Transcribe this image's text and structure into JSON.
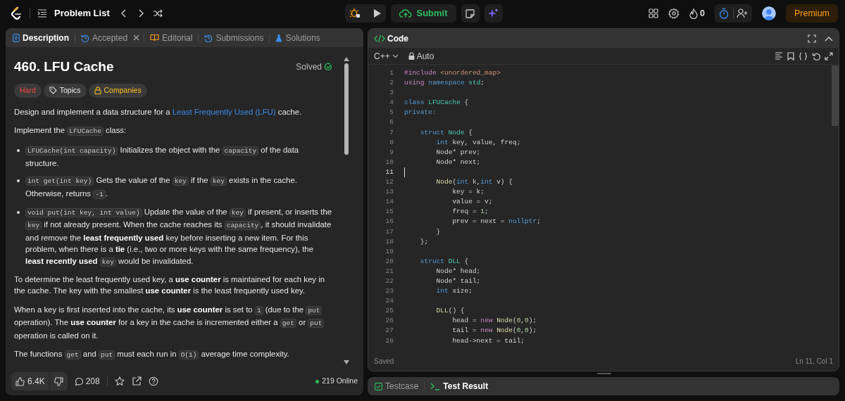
{
  "top_bar": {
    "problem_list": "Problem List",
    "submit": "Submit",
    "streak": "0",
    "premium": "Premium"
  },
  "description_panel": {
    "tabs": [
      {
        "label": "Description",
        "selected": true
      },
      {
        "label": "Accepted",
        "selected": false
      },
      {
        "label": "Editorial",
        "selected": false
      },
      {
        "label": "Submissions",
        "selected": false
      },
      {
        "label": "Solutions",
        "selected": false
      }
    ],
    "title": "460. LFU Cache",
    "status": "Solved",
    "tags": [
      {
        "label": "Hard",
        "kind": "difficulty"
      },
      {
        "label": "Topics",
        "kind": "topics"
      },
      {
        "label": "Companies",
        "kind": "companies"
      }
    ],
    "content": [
      {
        "kind": "paragraph",
        "segments": [
          {
            "kind": "text",
            "text": "Design and implement a data structure for a "
          },
          {
            "kind": "link",
            "text": "Least Frequently Used (LFU)"
          },
          {
            "kind": "text",
            "text": " cache."
          }
        ]
      },
      {
        "kind": "paragraph",
        "segments": [
          {
            "kind": "text",
            "text": "Implement the "
          },
          {
            "kind": "code",
            "text": "LFUCache"
          },
          {
            "kind": "text",
            "text": " class:"
          }
        ]
      },
      {
        "kind": "bullets",
        "items": [
          {
            "segments": [
              {
                "kind": "code",
                "text": "LFUCache(int capacity)"
              },
              {
                "kind": "text",
                "text": " Initializes the object with the "
              },
              {
                "kind": "code",
                "text": "capacity"
              },
              {
                "kind": "text",
                "text": " of the data structure."
              }
            ]
          },
          {
            "segments": [
              {
                "kind": "code",
                "text": "int get(int key)"
              },
              {
                "kind": "text",
                "text": " Gets the value of the "
              },
              {
                "kind": "code",
                "text": "key"
              },
              {
                "kind": "text",
                "text": " if the "
              },
              {
                "kind": "code",
                "text": "key"
              },
              {
                "kind": "text",
                "text": " exists in the cache. Otherwise, returns "
              },
              {
                "kind": "code",
                "text": "-1"
              },
              {
                "kind": "text",
                "text": "."
              }
            ]
          },
          {
            "segments": [
              {
                "kind": "code",
                "text": "void put(int key, int value)"
              },
              {
                "kind": "text",
                "text": " Update the value of the "
              },
              {
                "kind": "code",
                "text": "key"
              },
              {
                "kind": "text",
                "text": " if present, or inserts the "
              },
              {
                "kind": "code",
                "text": "key"
              },
              {
                "kind": "text",
                "text": " if not already present. When the cache reaches its "
              },
              {
                "kind": "code",
                "text": "capacity"
              },
              {
                "kind": "text",
                "text": ", it should invalidate and remove the **least frequently used** key before inserting a new item. For this problem, when there is a **tie** (i.e., two or more keys with the same frequency), the **least recently used** "
              },
              {
                "kind": "code",
                "text": "key"
              },
              {
                "kind": "text",
                "text": " would be invalidated."
              }
            ]
          }
        ]
      },
      {
        "kind": "paragraph",
        "segments": [
          {
            "kind": "text",
            "text": "To determine the least frequently used key, a **use counter** is maintained for each key in the cache. The key with the smallest **use counter** is the least frequently used key."
          }
        ]
      },
      {
        "kind": "paragraph",
        "segments": [
          {
            "kind": "text",
            "text": "When a key is first inserted into the cache, its **use counter** is set to "
          },
          {
            "kind": "code",
            "text": "1"
          },
          {
            "kind": "text",
            "text": " (due to the "
          },
          {
            "kind": "code",
            "text": "put"
          },
          {
            "kind": "text",
            "text": " operation). The **use counter** for a key in the cache is incremented either a "
          },
          {
            "kind": "code",
            "text": "get"
          },
          {
            "kind": "text",
            "text": " or "
          },
          {
            "kind": "code",
            "text": "put"
          },
          {
            "kind": "text",
            "text": " operation is called on it."
          }
        ]
      },
      {
        "kind": "paragraph",
        "segments": [
          {
            "kind": "text",
            "text": "The functions "
          },
          {
            "kind": "code",
            "text": "get"
          },
          {
            "kind": "text",
            "text": " and "
          },
          {
            "kind": "code",
            "text": "put"
          },
          {
            "kind": "text",
            "text": " must each run in "
          },
          {
            "kind": "code",
            "text": "O(1)"
          },
          {
            "kind": "text",
            "text": " average time complexity."
          }
        ]
      }
    ],
    "footer": {
      "likes": "6.4K",
      "comments": "208",
      "online": "219 Online"
    }
  },
  "code_panel": {
    "title": "Code",
    "language": "C++",
    "mode": "Auto",
    "lines": [
      {
        "number": "1",
        "current": false,
        "tokens": [
          {
            "text": "#include ",
            "kind": "preproc"
          },
          {
            "text": "<unordered_map>",
            "kind": "string"
          }
        ]
      },
      {
        "number": "2",
        "current": false,
        "tokens": [
          {
            "text": "using ",
            "kind": "preproc"
          },
          {
            "text": "namespace ",
            "kind": "keyword"
          },
          {
            "text": "std",
            "kind": "type"
          },
          {
            "text": ";",
            "kind": "plain"
          }
        ]
      },
      {
        "number": "3",
        "current": false
      },
      {
        "number": "4",
        "current": false,
        "tokens": [
          {
            "text": "class ",
            "kind": "keyword"
          },
          {
            "text": "LFUCache",
            "kind": "type"
          },
          {
            "text": " {",
            "kind": "plain"
          }
        ]
      },
      {
        "number": "5",
        "current": false,
        "tokens": [
          {
            "text": "private:",
            "kind": "keyword"
          }
        ]
      },
      {
        "number": "6",
        "current": false
      },
      {
        "number": "7",
        "current": false,
        "tokens": [
          {
            "text": "    struct ",
            "kind": "keyword"
          },
          {
            "text": "Node",
            "kind": "type"
          },
          {
            "text": " {",
            "kind": "plain"
          }
        ]
      },
      {
        "number": "8",
        "current": false,
        "tokens": [
          {
            "text": "        int ",
            "kind": "keyword"
          },
          {
            "text": "key, value, freq;",
            "kind": "plain"
          }
        ]
      },
      {
        "number": "9",
        "current": false,
        "tokens": [
          {
            "text": "        Node* prev;",
            "kind": "plain"
          }
        ]
      },
      {
        "number": "10",
        "current": false,
        "tokens": [
          {
            "text": "        Node* next;",
            "kind": "plain"
          }
        ]
      },
      {
        "number": "11",
        "current": true
      },
      {
        "number": "12",
        "current": false,
        "tokens": [
          {
            "text": "        Node",
            "kind": "function"
          },
          {
            "text": "(",
            "kind": "plain"
          },
          {
            "text": "int ",
            "kind": "keyword"
          },
          {
            "text": "k,",
            "kind": "plain"
          },
          {
            "text": "int ",
            "kind": "keyword"
          },
          {
            "text": "v) {",
            "kind": "plain"
          }
        ]
      },
      {
        "number": "13",
        "current": false,
        "tokens": [
          {
            "text": "            key = k;",
            "kind": "plain"
          }
        ]
      },
      {
        "number": "14",
        "current": false,
        "tokens": [
          {
            "text": "            value = v;",
            "kind": "plain"
          }
        ]
      },
      {
        "number": "15",
        "current": false,
        "tokens": [
          {
            "text": "            freq = ",
            "kind": "plain"
          },
          {
            "text": "1",
            "kind": "number"
          },
          {
            "text": ";",
            "kind": "plain"
          }
        ]
      },
      {
        "number": "16",
        "current": false,
        "tokens": [
          {
            "text": "            prev = next = ",
            "kind": "plain"
          },
          {
            "text": "nullptr",
            "kind": "keyword"
          },
          {
            "text": ";",
            "kind": "plain"
          }
        ]
      },
      {
        "number": "17",
        "current": false,
        "tokens": [
          {
            "text": "        }",
            "kind": "plain"
          }
        ]
      },
      {
        "number": "18",
        "current": false,
        "tokens": [
          {
            "text": "    };",
            "kind": "plain"
          }
        ]
      },
      {
        "number": "19",
        "current": false
      },
      {
        "number": "20",
        "current": false,
        "tokens": [
          {
            "text": "    struct ",
            "kind": "keyword"
          },
          {
            "text": "DLL",
            "kind": "type"
          },
          {
            "text": " {",
            "kind": "plain"
          }
        ]
      },
      {
        "number": "21",
        "current": false,
        "tokens": [
          {
            "text": "        Node* head;",
            "kind": "plain"
          }
        ]
      },
      {
        "number": "22",
        "current": false,
        "tokens": [
          {
            "text": "        Node* tail;",
            "kind": "plain"
          }
        ]
      },
      {
        "number": "23",
        "current": false,
        "tokens": [
          {
            "text": "        int ",
            "kind": "keyword"
          },
          {
            "text": "size;",
            "kind": "plain"
          }
        ]
      },
      {
        "number": "24",
        "current": false
      },
      {
        "number": "25",
        "current": false,
        "tokens": [
          {
            "text": "        DLL",
            "kind": "function"
          },
          {
            "text": "() {",
            "kind": "plain"
          }
        ]
      },
      {
        "number": "26",
        "current": false,
        "tokens": [
          {
            "text": "            head = ",
            "kind": "plain"
          },
          {
            "text": "new ",
            "kind": "control"
          },
          {
            "text": "Node",
            "kind": "function"
          },
          {
            "text": "(",
            "kind": "plain"
          },
          {
            "text": "0",
            "kind": "number"
          },
          {
            "text": ",",
            "kind": "plain"
          },
          {
            "text": "0",
            "kind": "number"
          },
          {
            "text": ");",
            "kind": "plain"
          }
        ]
      },
      {
        "number": "27",
        "current": false,
        "tokens": [
          {
            "text": "            tail = ",
            "kind": "plain"
          },
          {
            "text": "new ",
            "kind": "control"
          },
          {
            "text": "Node",
            "kind": "function"
          },
          {
            "text": "(",
            "kind": "plain"
          },
          {
            "text": "0",
            "kind": "number"
          },
          {
            "text": ",",
            "kind": "plain"
          },
          {
            "text": "0",
            "kind": "number"
          },
          {
            "text": ");",
            "kind": "plain"
          }
        ]
      },
      {
        "number": "28",
        "current": false,
        "tokens": [
          {
            "text": "            head->next = tail;",
            "kind": "plain"
          }
        ]
      }
    ],
    "save_status": "Saved",
    "cursor_position": "Ln 11, Col 1"
  },
  "console_panel": {
    "tabs": [
      {
        "label": "Testcase",
        "selected": false
      },
      {
        "label": "Test Result",
        "selected": true
      }
    ]
  }
}
